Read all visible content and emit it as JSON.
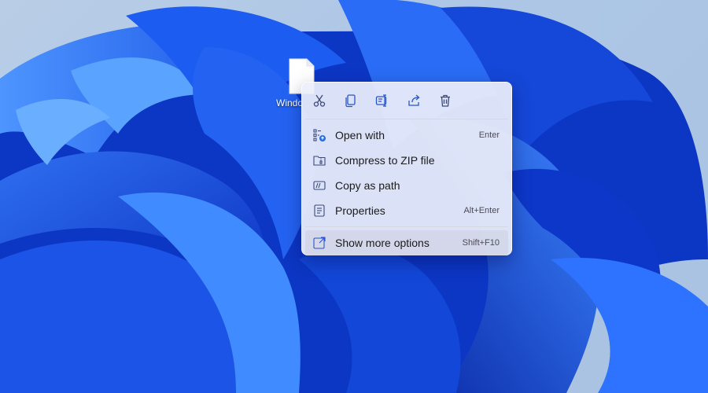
{
  "desktop": {
    "file_label": "Windo",
    "file_icon": "document-icon"
  },
  "context_menu": {
    "actions": [
      {
        "name": "cut",
        "icon": "scissors-icon"
      },
      {
        "name": "copy",
        "icon": "copy-icon"
      },
      {
        "name": "rename",
        "icon": "rename-icon"
      },
      {
        "name": "share",
        "icon": "share-icon"
      },
      {
        "name": "delete",
        "icon": "trash-icon"
      }
    ],
    "items": [
      {
        "label": "Open with",
        "shortcut": "Enter",
        "icon": "open-with-icon"
      },
      {
        "label": "Compress to ZIP file",
        "shortcut": "",
        "icon": "zip-folder-icon"
      },
      {
        "label": "Copy as path",
        "shortcut": "",
        "icon": "copy-path-icon"
      },
      {
        "label": "Properties",
        "shortcut": "Alt+Enter",
        "icon": "properties-icon"
      }
    ],
    "more": {
      "label": "Show more options",
      "shortcut": "Shift+F10",
      "icon": "show-more-icon"
    },
    "accent_color": "#0078d4"
  }
}
